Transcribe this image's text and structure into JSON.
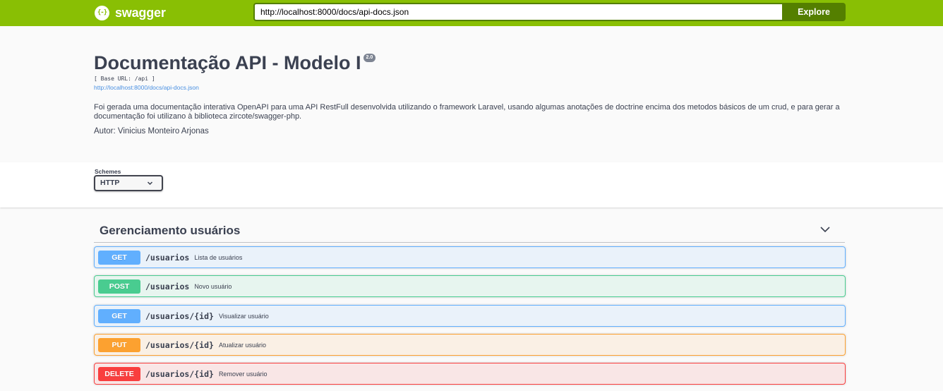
{
  "topbar": {
    "logo_text": "swagger",
    "logo_icon": "{-}",
    "url_value": "http://localhost:8000/docs/api-docs.json",
    "explore_label": "Explore",
    "brand_color": "#89bf04",
    "dark_color": "#547f00"
  },
  "info": {
    "title": "Documentação API - Modelo I",
    "version": "2.0",
    "base_url": "[ Base URL: /api ]",
    "spec_link": "http://localhost:8000/docs/api-docs.json",
    "description": "Foi gerada uma documentação interativa OpenAPI para uma API RestFull desenvolvida utilizando o framework Laravel, usando algumas anotações de doctrine encima dos metodos básicos de um crud, e para gerar a documentação foi utilizano à biblioteca zircote/swagger-php.",
    "author": "Autor: Vinicius Monteiro Arjonas"
  },
  "schemes": {
    "label": "Schemes",
    "selected": "HTTP"
  },
  "tag": {
    "title": "Gerenciamento usuários",
    "icon": "chevron-down-icon"
  },
  "operations": [
    {
      "method": "GET",
      "path": "/usuarios",
      "summary": "Lista de usuários",
      "color": "#61affe"
    },
    {
      "method": "POST",
      "path": "/usuarios",
      "summary": "Novo usuário",
      "color": "#49cc90"
    },
    {
      "method": "GET",
      "path": "/usuarios/{id}",
      "summary": "Visualizar usuário",
      "color": "#61affe"
    },
    {
      "method": "PUT",
      "path": "/usuarios/{id}",
      "summary": "Atualizar usuário",
      "color": "#fca130"
    },
    {
      "method": "DELETE",
      "path": "/usuarios/{id}",
      "summary": "Remover usuário",
      "color": "#f93e3e"
    }
  ]
}
